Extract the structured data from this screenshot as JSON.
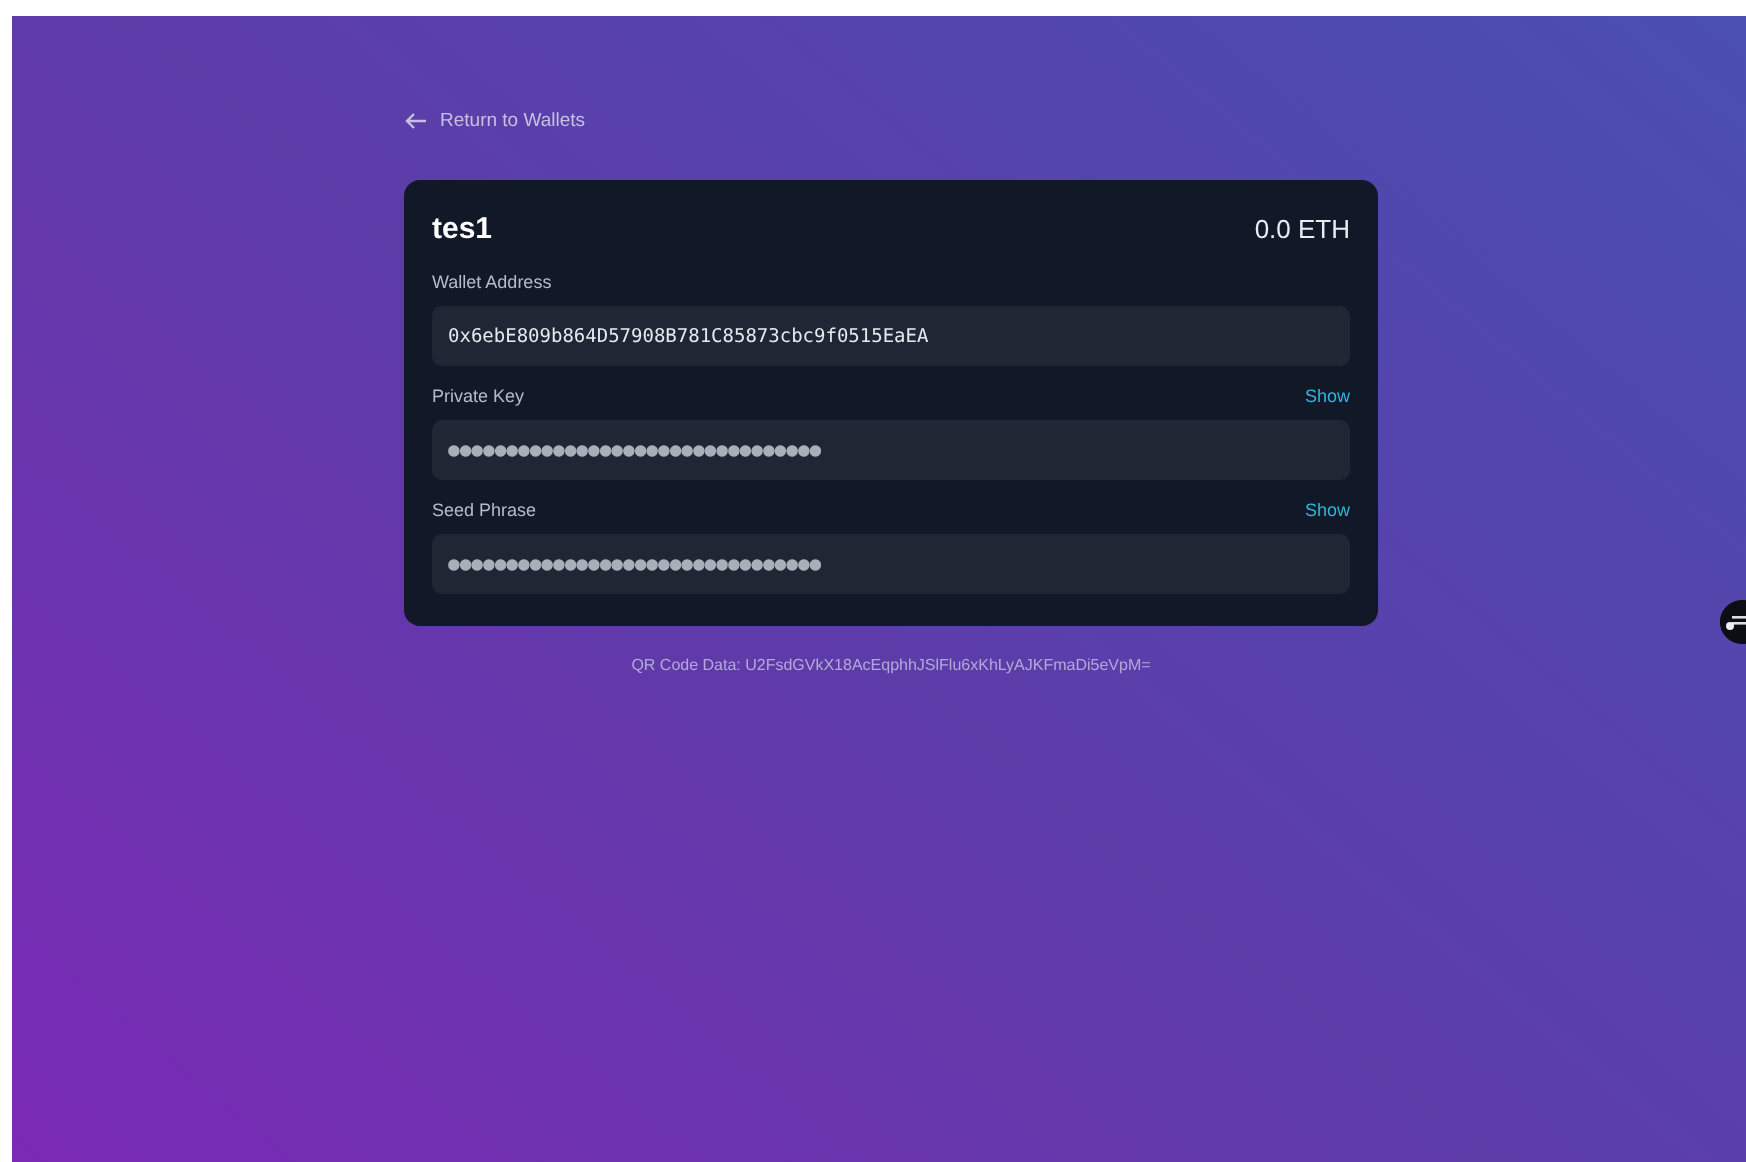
{
  "back_link": {
    "label": "Return to Wallets"
  },
  "wallet": {
    "name": "tes1",
    "balance": "0.0 ETH"
  },
  "fields": [
    {
      "label": "Wallet Address",
      "value": "0x6ebE809b864D57908B781C85873cbc9f0515EaEA",
      "masked": false
    },
    {
      "label": "Private Key",
      "value": "●●●●●●●●●●●●●●●●●●●●●●●●●●●●●●●●",
      "action": "Show",
      "masked": true
    },
    {
      "label": "Seed Phrase",
      "value": "●●●●●●●●●●●●●●●●●●●●●●●●●●●●●●●●",
      "action": "Show",
      "masked": true
    }
  ],
  "qr_code_data": "QR Code Data: U2FsdGVkX18AcEqphhJSlFlu6xKhLyAJKFmaDi5eVpM="
}
